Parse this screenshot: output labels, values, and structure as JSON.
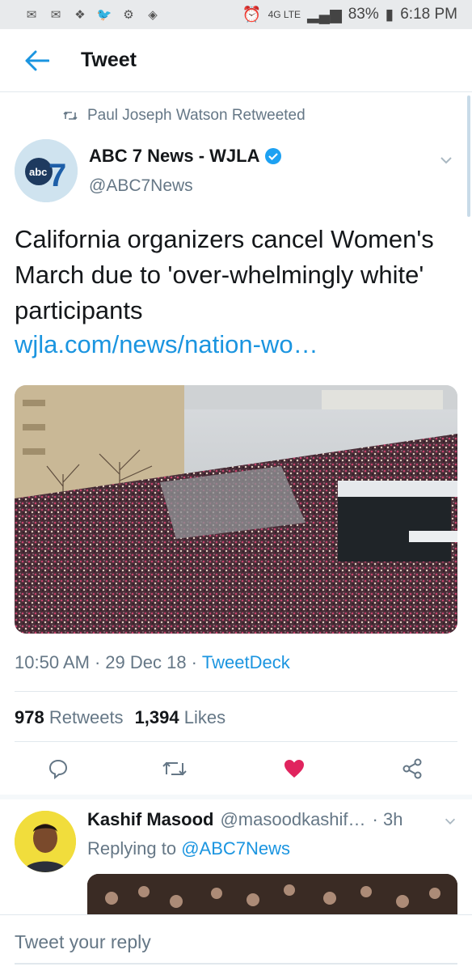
{
  "status_bar": {
    "battery": "83%",
    "time": "6:18 PM",
    "network": "4G LTE"
  },
  "app_bar": {
    "title": "Tweet"
  },
  "tweet": {
    "retweeted_by": "Paul Joseph Watson Retweeted",
    "author_name": "ABC 7 News - WJLA",
    "author_handle": "@ABC7News",
    "text": "California organizers cancel Women's March due to 'over-whelmingly white' participants",
    "link": "wjla.com/news/nation-wo…",
    "time": "10:50 AM",
    "date": "29 Dec 18",
    "source": "TweetDeck",
    "retweets_count": "978",
    "retweets_label": "Retweets",
    "likes_count": "1,394",
    "likes_label": "Likes"
  },
  "reply": {
    "name": "Kashif Masood",
    "handle": "@masoodkashif…",
    "age": "· 3h",
    "replying_prefix": "Replying to",
    "replying_to": "@ABC7News"
  },
  "compose": {
    "placeholder": "Tweet your reply"
  },
  "colors": {
    "accent": "#1b95e0",
    "like": "#e0245e",
    "muted": "#657786"
  }
}
